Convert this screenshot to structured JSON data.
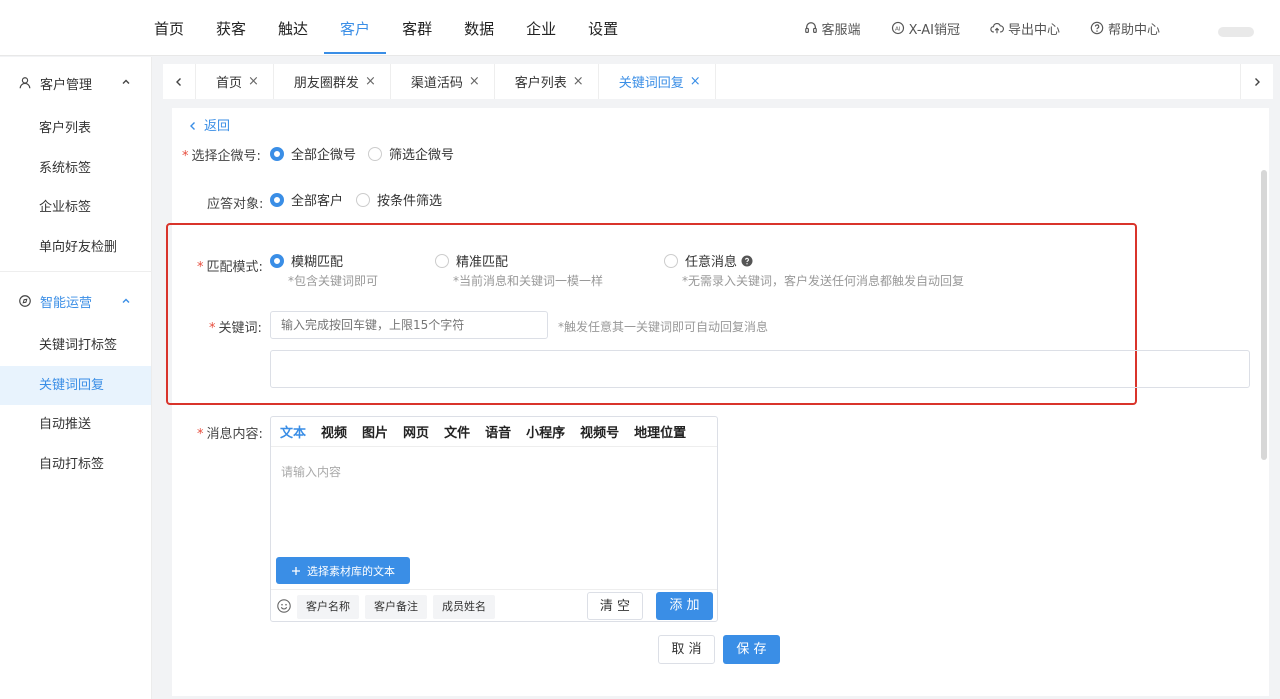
{
  "topnav": {
    "menu": [
      "首页",
      "获客",
      "触达",
      "客户",
      "客群",
      "数据",
      "企业",
      "设置"
    ],
    "active_index": 3,
    "tools": {
      "service": "客服端",
      "ai": "X-AI销冠",
      "export": "导出中心",
      "help": "帮助中心"
    }
  },
  "sidebar": {
    "group1": "客户管理",
    "group1_items": [
      "客户列表",
      "系统标签",
      "企业标签",
      "单向好友检删"
    ],
    "group2": "智能运营",
    "group2_items": [
      "关键词打标签",
      "关键词回复",
      "自动推送",
      "自动打标签"
    ],
    "active_item": "关键词回复"
  },
  "tabs": [
    "首页",
    "朋友圈群发",
    "渠道活码",
    "客户列表",
    "关键词回复"
  ],
  "tab_close": "×",
  "active_tab": "关键词回复",
  "form": {
    "back": "返回",
    "select_account_label": "选择企微号:",
    "select_account_opt1": "全部企微号",
    "select_account_opt2": "筛选企微号",
    "reply_target_label": "应答对象:",
    "reply_target_opt1": "全部客户",
    "reply_target_opt2": "按条件筛选",
    "match_label": "匹配模式:",
    "match_fuzzy": "模糊匹配",
    "match_fuzzy_hint": "*包含关键词即可",
    "match_exact": "精准匹配",
    "match_exact_hint": "*当前消息和关键词一模一样",
    "match_any": "任意消息",
    "match_any_hint": "*无需录入关键词，客户发送任何消息都触发自动回复",
    "keyword_label": "关键词:",
    "keyword_placeholder": "输入完成按回车键，上限15个字符",
    "keyword_hint": "*触发任意其一关键词即可自动回复消息",
    "message_label": "消息内容:",
    "message_tabs": [
      "文本",
      "视频",
      "图片",
      "网页",
      "文件",
      "语音",
      "小程序",
      "视频号",
      "地理位置"
    ],
    "message_placeholder": "请输入内容",
    "library_button": "选择素材库的文本",
    "var_chips": [
      "客户名称",
      "客户备注",
      "成员姓名"
    ],
    "clear_button": "清 空",
    "add_button": "添 加",
    "cancel_button": "取 消",
    "save_button": "保 存"
  },
  "colors": {
    "accent": "#3a8ee6",
    "highlight_border": "#d9342b",
    "required": "#e74c3c"
  }
}
